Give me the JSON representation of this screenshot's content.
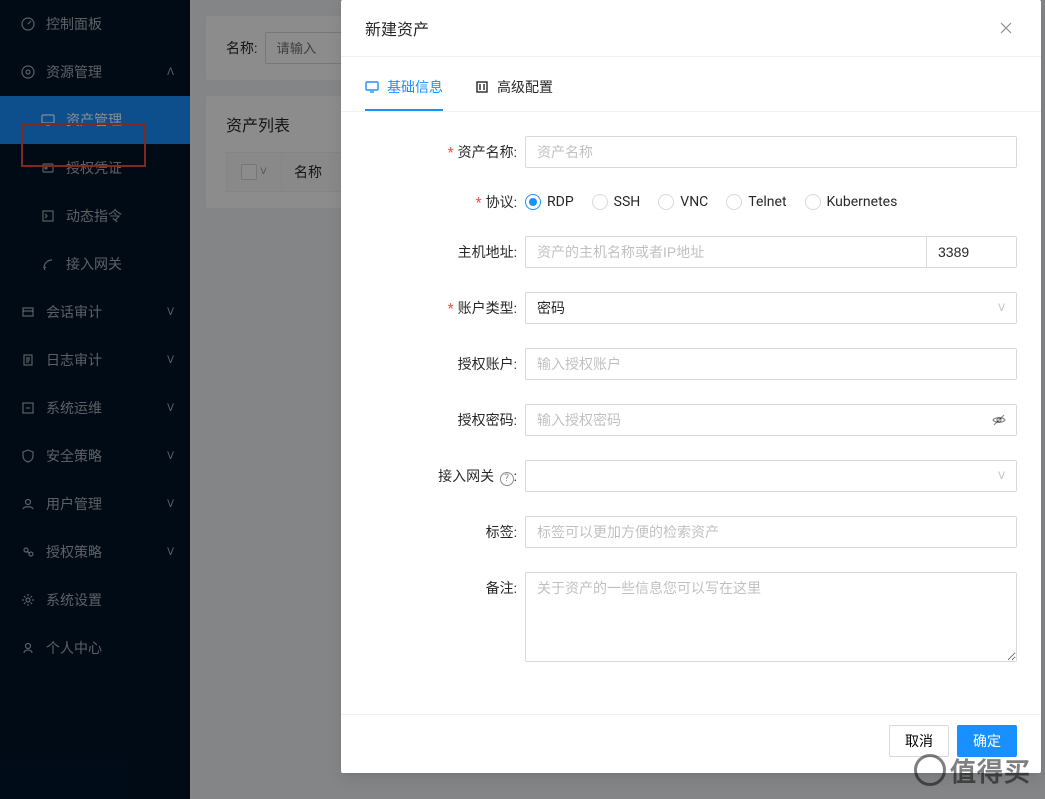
{
  "sidebar": {
    "items": [
      {
        "label": "控制面板",
        "icon": "dashboard"
      },
      {
        "label": "资源管理",
        "icon": "resource",
        "expanded": true
      },
      {
        "label": "资产管理",
        "icon": "monitor",
        "sub": true,
        "active": true
      },
      {
        "label": "授权凭证",
        "icon": "key",
        "sub": true
      },
      {
        "label": "动态指令",
        "icon": "command",
        "sub": true
      },
      {
        "label": "接入网关",
        "icon": "gateway",
        "sub": true
      },
      {
        "label": "会话审计",
        "icon": "session",
        "arrow": "down"
      },
      {
        "label": "日志审计",
        "icon": "log",
        "arrow": "down"
      },
      {
        "label": "系统运维",
        "icon": "ops",
        "arrow": "down"
      },
      {
        "label": "安全策略",
        "icon": "shield",
        "arrow": "down"
      },
      {
        "label": "用户管理",
        "icon": "user",
        "arrow": "down"
      },
      {
        "label": "授权策略",
        "icon": "policy",
        "arrow": "down"
      },
      {
        "label": "系统设置",
        "icon": "gear"
      },
      {
        "label": "个人中心",
        "icon": "person"
      }
    ]
  },
  "filter": {
    "label": "名称:",
    "placeholder": "请输入"
  },
  "list": {
    "title": "资产列表",
    "col_name": "名称"
  },
  "modal": {
    "title": "新建资产",
    "tabs": {
      "basic": "基础信息",
      "advanced": "高级配置"
    },
    "labels": {
      "name": "资产名称",
      "protocol": "协议",
      "host": "主机地址",
      "account_type": "账户类型",
      "auth_account": "授权账户",
      "auth_password": "授权密码",
      "gateway": "接入网关",
      "tags": "标签",
      "remark": "备注"
    },
    "placeholders": {
      "name": "资产名称",
      "host": "资产的主机名称或者IP地址",
      "auth_account": "输入授权账户",
      "auth_password": "输入授权密码",
      "tags": "标签可以更加方便的检索资产",
      "remark": "关于资产的一些信息您可以写在这里"
    },
    "values": {
      "port": "3389",
      "account_type": "密码"
    },
    "protocols": [
      "RDP",
      "SSH",
      "VNC",
      "Telnet",
      "Kubernetes"
    ],
    "protocol_selected": "RDP",
    "footer": {
      "cancel": "取消",
      "ok": "确定"
    }
  },
  "watermark": "值得买"
}
